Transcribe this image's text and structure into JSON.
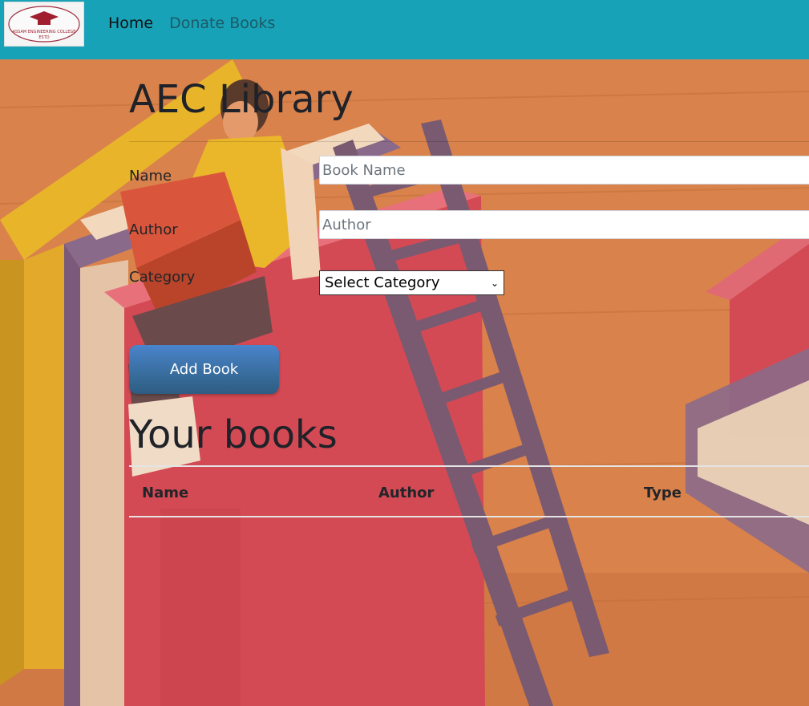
{
  "nav": {
    "logo_text": "ASSAM ENGINEERING COLLEGE",
    "logo_sub": "ESTD",
    "links": [
      {
        "label": "Home",
        "active": true
      },
      {
        "label": "Donate Books",
        "active": false
      }
    ]
  },
  "colors": {
    "navbar": "#17a2b8",
    "button": "#3f77b3",
    "background": "#d9824b"
  },
  "main": {
    "title": "AEC Library",
    "form": {
      "name_label": "Name",
      "name_placeholder": "Book Name",
      "author_label": "Author",
      "author_placeholder": "Author",
      "category_label": "Category",
      "category_selected": "Select Category",
      "submit_label": "Add Book"
    },
    "books": {
      "title": "Your books",
      "columns": [
        "Name",
        "Author",
        "Type"
      ],
      "rows": []
    }
  }
}
